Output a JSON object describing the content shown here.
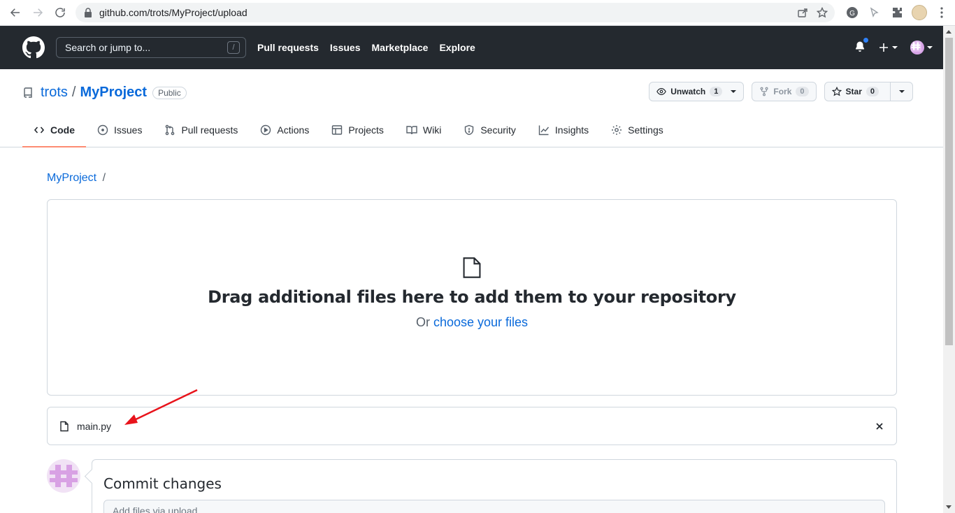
{
  "browser": {
    "url": "github.com/trots/MyProject/upload",
    "back_icon": "arrow-left-icon",
    "forward_icon": "arrow-right-icon",
    "reload_icon": "reload-icon"
  },
  "header": {
    "search_placeholder": "Search or jump to...",
    "search_shortcut": "/",
    "nav": [
      "Pull requests",
      "Issues",
      "Marketplace",
      "Explore"
    ]
  },
  "repo": {
    "owner": "trots",
    "separator": "/",
    "name": "MyProject",
    "visibility": "Public",
    "watch_label": "Unwatch",
    "watch_count": "1",
    "fork_label": "Fork",
    "fork_count": "0",
    "star_label": "Star",
    "star_count": "0"
  },
  "tabs": [
    {
      "label": "Code",
      "icon": "code-icon"
    },
    {
      "label": "Issues",
      "icon": "issue-icon"
    },
    {
      "label": "Pull requests",
      "icon": "pull-request-icon"
    },
    {
      "label": "Actions",
      "icon": "play-icon"
    },
    {
      "label": "Projects",
      "icon": "table-icon"
    },
    {
      "label": "Wiki",
      "icon": "book-icon"
    },
    {
      "label": "Security",
      "icon": "shield-icon"
    },
    {
      "label": "Insights",
      "icon": "graph-icon"
    },
    {
      "label": "Settings",
      "icon": "gear-icon"
    }
  ],
  "breadcrumb": {
    "repo": "MyProject",
    "sep": "/"
  },
  "dropzone": {
    "headline": "Drag additional files here to add them to your repository",
    "or_text": "Or",
    "choose_link": "choose your files"
  },
  "uploaded_file": {
    "name": "main.py"
  },
  "commit": {
    "title": "Commit changes",
    "placeholder": "Add files via upload"
  },
  "colors": {
    "header_bg": "#24292f",
    "link": "#0969da",
    "active_tab_underline": "#fd8c73",
    "annotation_arrow": "#e8131b"
  }
}
